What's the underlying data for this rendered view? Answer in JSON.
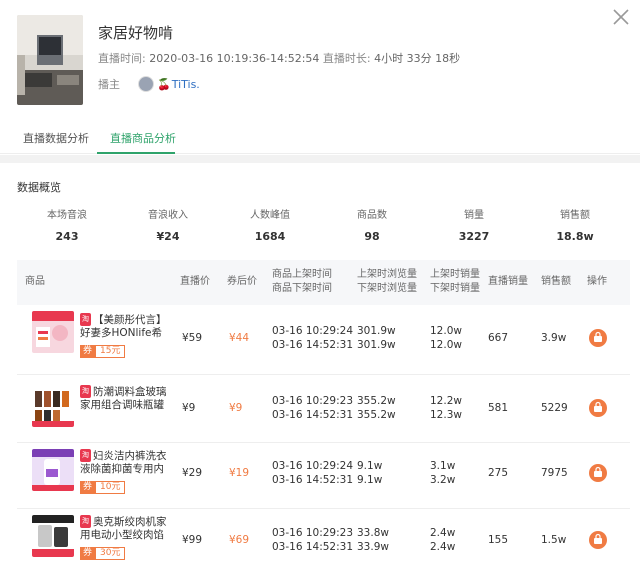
{
  "header": {
    "title": "家居好物啃",
    "time_label": "直播时间:",
    "time_value": "2020-03-16 10:19:36-14:52:54",
    "duration_label": "直播时长:",
    "duration_value": "4小时 33分 18秒",
    "host_label": "播主",
    "host_name": "TiTis."
  },
  "tabs": [
    {
      "label": "直播数据分析",
      "active": false
    },
    {
      "label": "直播商品分析",
      "active": true
    }
  ],
  "overview": {
    "title": "数据概览",
    "stats": [
      {
        "label": "本场音浪",
        "value": "243"
      },
      {
        "label": "音浪收入",
        "value": "¥24"
      },
      {
        "label": "人数峰值",
        "value": "1684"
      },
      {
        "label": "商品数",
        "value": "98"
      },
      {
        "label": "销量",
        "value": "3227"
      },
      {
        "label": "销售额",
        "value": "18.8w"
      }
    ]
  },
  "table": {
    "headers": {
      "product": "商品",
      "live_price": "直播价",
      "after_coupon": "券后价",
      "time_on": "商品上架时间",
      "time_off": "商品下架时间",
      "views_on": "上架时浏览量",
      "views_off": "下架时浏览量",
      "sales_on": "上架时销量",
      "sales_off": "下架时销量",
      "live_sales": "直播销量",
      "revenue": "销售额",
      "action": "操作"
    },
    "rows": [
      {
        "name": "【美颜彤代言】好妻多HONlife希亚籽...",
        "coupon_prefix": "券",
        "coupon": "15元",
        "live_price": "¥59",
        "after_coupon": "¥44",
        "time_on": "03-16 10:29:24",
        "time_off": "03-16 14:52:31",
        "views_on": "301.9w",
        "views_off": "301.9w",
        "sales_on": "12.0w",
        "sales_off": "12.0w",
        "live_sales": "667",
        "revenue": "3.9w"
      },
      {
        "name": "防潮调料盒玻璃家用组合调味瓶罐子...",
        "coupon_prefix": "",
        "coupon": "",
        "live_price": "¥9",
        "after_coupon": "¥9",
        "time_on": "03-16 10:29:23",
        "time_off": "03-16 14:52:31",
        "views_on": "355.2w",
        "views_off": "355.2w",
        "sales_on": "12.2w",
        "sales_off": "12.3w",
        "live_sales": "581",
        "revenue": "5229"
      },
      {
        "name": "妇炎洁内裤洗衣液除菌抑菌专用内衣...",
        "coupon_prefix": "券",
        "coupon": "10元",
        "live_price": "¥29",
        "after_coupon": "¥19",
        "time_on": "03-16 10:29:24",
        "time_off": "03-16 14:52:31",
        "views_on": "9.1w",
        "views_off": "9.1w",
        "sales_on": "3.1w",
        "sales_off": "3.2w",
        "live_sales": "275",
        "revenue": "7975"
      },
      {
        "name": "奥克斯绞肉机家用电动小型绞肉馅机...",
        "coupon_prefix": "券",
        "coupon": "30元",
        "live_price": "¥99",
        "after_coupon": "¥69",
        "time_on": "03-16 10:29:23",
        "time_off": "03-16 14:52:31",
        "views_on": "33.8w",
        "views_off": "33.9w",
        "sales_on": "2.4w",
        "sales_off": "2.4w",
        "live_sales": "155",
        "revenue": "1.5w"
      }
    ]
  }
}
